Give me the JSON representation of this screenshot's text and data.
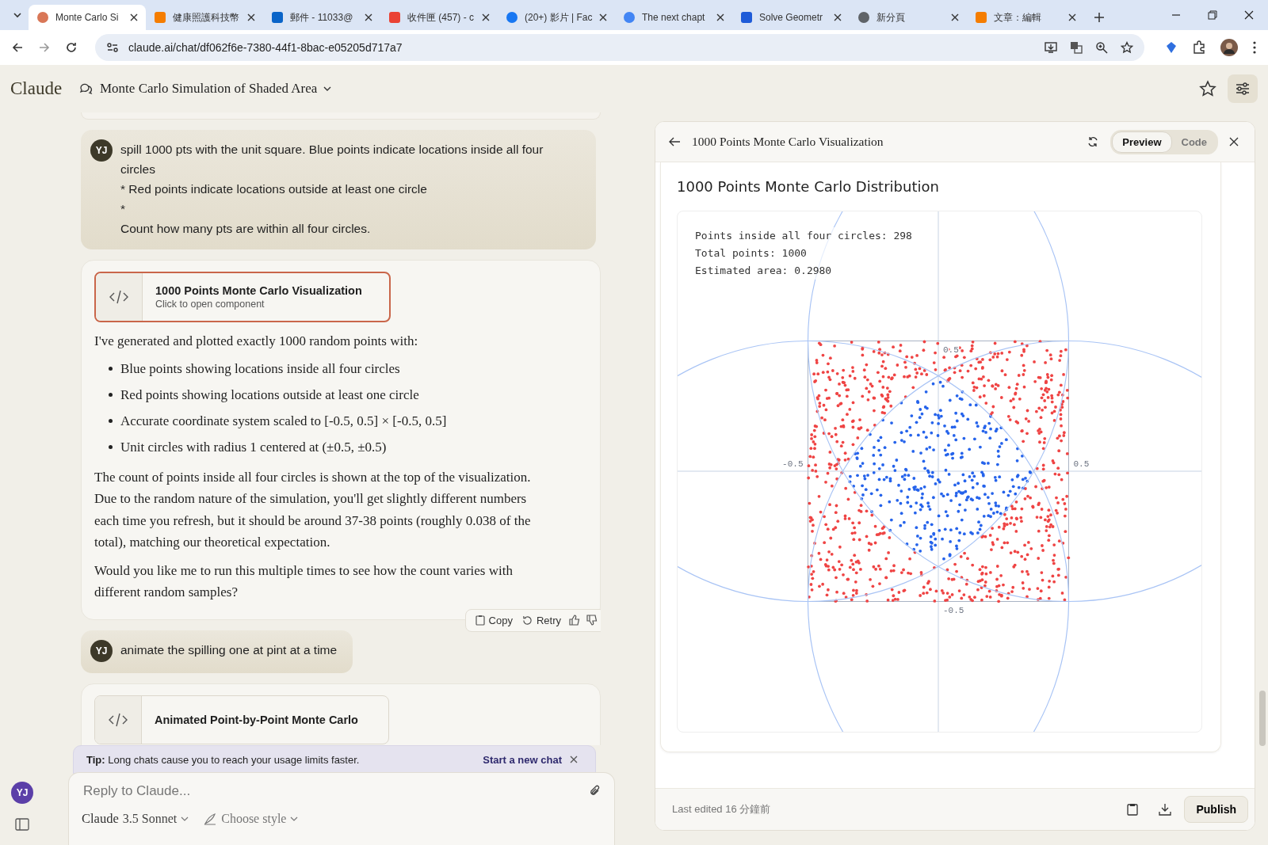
{
  "browser": {
    "tabs": [
      {
        "title": "Monte Carlo Si",
        "kind": "claude",
        "selected": true
      },
      {
        "title": "健康照護科技幣",
        "kind": "blogger",
        "selected": false
      },
      {
        "title": "郵件 - 11033@",
        "kind": "outlook",
        "selected": false
      },
      {
        "title": "收件匣 (457) - c",
        "kind": "gmail",
        "selected": false
      },
      {
        "title": "(20+) 影片 | Fac",
        "kind": "facebook",
        "selected": false
      },
      {
        "title": "The next chapt",
        "kind": "google",
        "selected": false
      },
      {
        "title": "Solve Geometr",
        "kind": "geometry",
        "selected": false
      },
      {
        "title": "新分頁",
        "kind": "chrome",
        "selected": false
      },
      {
        "title": "文章：編輯",
        "kind": "blogger",
        "selected": false
      }
    ],
    "url": "claude.ai/chat/df062f6e-7380-44f1-8bac-e05205d717a7"
  },
  "app": {
    "brand": "Claude",
    "chat_title": "Monte Carlo Simulation of Shaded Area",
    "avatar": "YJ",
    "messages": [
      {
        "kind": "user",
        "avatar": "YJ",
        "lines": [
          "spill 1000 pts with the unit square. Blue points indicate locations inside all four circles",
          "* Red points indicate locations outside at least one circle",
          "*",
          "Count how many pts are within all four circles."
        ]
      },
      {
        "kind": "assistant",
        "artifact": {
          "title": "1000 Points Monte Carlo Visualization",
          "subtitle": "Click to open component",
          "active": true
        },
        "blocks": [
          {
            "kind": "paragraph",
            "text": "I've generated and plotted exactly 1000 random points with:"
          },
          {
            "kind": "bullets",
            "items": [
              "Blue points showing locations inside all four circles",
              "Red points showing locations outside at least one circle",
              "Accurate coordinate system scaled to [-0.5, 0.5] × [-0.5, 0.5]",
              "Unit circles with radius 1 centered at (±0.5, ±0.5)"
            ]
          },
          {
            "kind": "paragraph",
            "text": "The count of points inside all four circles is shown at the top of the visualization. Due to the random nature of the simulation, you'll get slightly different numbers each time you refresh, but it should be around 37-38 points (roughly 0.038 of the total), matching our theoretical expectation."
          },
          {
            "kind": "paragraph",
            "text": "Would you like me to run this multiple times to see how the count varies with different random samples?"
          }
        ],
        "actions": [
          "Copy",
          "Retry"
        ]
      },
      {
        "kind": "user",
        "avatar": "YJ",
        "lines": [
          "animate the spilling one at pint at a time"
        ]
      },
      {
        "kind": "assistant",
        "artifact": {
          "title": "Animated Point-by-Point Monte Carlo",
          "active": false
        }
      }
    ],
    "tip": {
      "text": "**Tip:** Long chats cause you to reach your usage limits faster.",
      "link": "Start a new chat"
    },
    "composer": {
      "placeholder": "Reply to Claude...",
      "model_brand": "Claude",
      "model_version": "3.5 Sonnet",
      "style": "Choose style"
    }
  },
  "artifact": {
    "title": "1000 Points Monte Carlo Visualization",
    "views": [
      {
        "label": "Preview",
        "selected": true
      },
      {
        "label": "Code",
        "selected": false
      }
    ],
    "heading": "1000 Points Monte Carlo Distribution",
    "stats": [
      "Points inside all four circles: 298",
      "Total points: 1000",
      "Estimated area: 0.2980"
    ],
    "ticks": [
      {
        "kind": "top",
        "label": "0.5"
      },
      {
        "kind": "left",
        "label": "-0.5"
      },
      {
        "kind": "right",
        "label": "0.5"
      },
      {
        "kind": "bottom",
        "label": "-0.5"
      }
    ],
    "footer": {
      "edited": "Last edited 16 分鐘前",
      "publish": "Publish"
    }
  }
}
